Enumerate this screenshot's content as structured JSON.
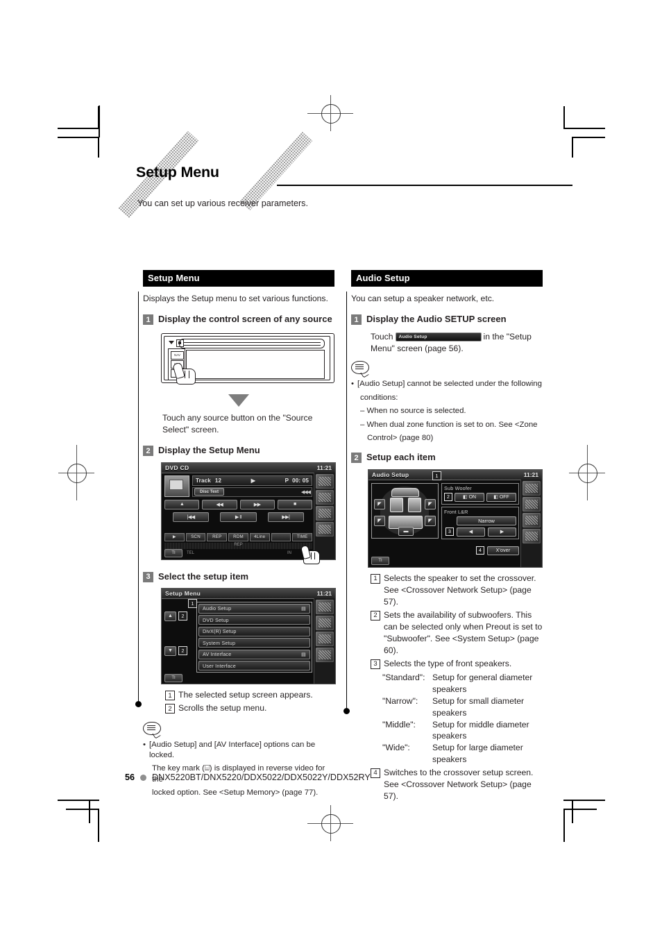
{
  "header": {
    "title": "Setup Menu",
    "subtitle": "You can set up various receiver parameters."
  },
  "left_column": {
    "section_title": "Setup Menu",
    "intro": "Displays the Setup menu to set various functions.",
    "step1": {
      "num": "1",
      "label": "Display the control screen of any source",
      "after_text_line1": "Touch any source button on the \"Source Select\"",
      "after_text_line2": "screen."
    },
    "step2": {
      "num": "2",
      "label": "Display the Setup Menu",
      "screen": {
        "title": "DVD CD",
        "clock": "11:21",
        "track_label": "Track",
        "track_num": "12",
        "play_icon": "▶",
        "p_label": "P",
        "time": "00: 05",
        "disc_text_button": "Disc Text",
        "scroll_arrows": "◀◀◀",
        "keys_row1": [
          "▲",
          "◀◀",
          "▶▶",
          "■"
        ],
        "keys_row2": [
          "|◀◀",
          "▶ II",
          "▶▶|"
        ],
        "func_keys": [
          "▶",
          "SCN",
          "REP",
          "RDM",
          "4Line",
          "",
          "TIME"
        ],
        "status": "REP",
        "tl_button": "TI",
        "tel_label": "TEL",
        "in_label": "IN"
      }
    },
    "step3": {
      "num": "3",
      "label": "Select the setup item",
      "screen": {
        "title": "Setup Menu",
        "clock": "11:21",
        "callout_1": "1",
        "callout_2": "2",
        "up_arrow": "▲",
        "down_arrow": "▼",
        "items": [
          {
            "label": "Audio Setup",
            "locked": "▤"
          },
          {
            "label": "DVD Setup",
            "locked": ""
          },
          {
            "label": "DivX(R) Setup",
            "locked": ""
          },
          {
            "label": "System Setup",
            "locked": ""
          },
          {
            "label": "AV Interface",
            "locked": "▤"
          },
          {
            "label": "User Interface",
            "locked": ""
          }
        ],
        "tl_button": "TI"
      },
      "callouts": [
        {
          "n": "1",
          "text": "The selected setup screen appears."
        },
        {
          "n": "2",
          "text": "Scrolls the setup menu."
        }
      ],
      "note": {
        "line1": "[Audio Setup]  and [AV Interface] options can be locked.",
        "line2": "The key mark (⌸) is displayed in reverse video for the",
        "line3": "locked option. See <Setup Memory> (page 77)."
      }
    }
  },
  "right_column": {
    "section_title": "Audio Setup",
    "intro": "You can setup a speaker network, etc.",
    "step1": {
      "num": "1",
      "label": "Display the Audio SETUP screen",
      "touch_prefix": "Touch",
      "pill_label": "Audio Setup",
      "touch_mid": "in the \"Setup",
      "touch_suffix": "Menu\" screen (page 56)."
    },
    "note": {
      "line1": "[Audio Setup] cannot be selected under the following",
      "line2": "conditions:",
      "sub1": "– When no source is selected.",
      "sub2": "– When dual zone function is set to on. See <Zone",
      "sub3": "Control> (page 80)"
    },
    "step2": {
      "num": "2",
      "label": "Setup each item",
      "screen": {
        "title": "Audio Setup",
        "clock": "11:21",
        "callout_1": "1",
        "callout_2": "2",
        "callout_3": "3",
        "callout_4": "4",
        "subwoofer_label": "Sub Woofer",
        "on_label": "ON",
        "off_label": "OFF",
        "front_label": "Front L&R",
        "front_value": "Narrow",
        "left_arrow": "◀",
        "right_arrow": "▶",
        "xover_button": "X'over",
        "speaker_icon": "◤",
        "subwoofer_icon": "▬",
        "tl_button": "TI"
      }
    },
    "callouts": [
      {
        "n": "1",
        "lines": [
          "Selects the speaker to set the crossover. See",
          "<Crossover Network Setup> (page 57)."
        ]
      },
      {
        "n": "2",
        "lines": [
          "Sets the availability of subwoofers. This",
          "can be selected only when Preout is set to",
          "\"Subwoofer\". See <System Setup> (page",
          "60)."
        ]
      },
      {
        "n": "3",
        "lines": [
          "Selects the type of front speakers."
        ]
      },
      {
        "n": "4",
        "lines": [
          "Switches to the crossover setup screen.",
          "See <Crossover Network Setup> (page 57)."
        ]
      }
    ],
    "speaker_types": [
      {
        "name": "\"Standard\":",
        "desc": "Setup for general diameter",
        "cont": "speakers"
      },
      {
        "name": "\"Narrow\":",
        "desc": "Setup for small diameter",
        "cont": "speakers"
      },
      {
        "name": "\"Middle\":",
        "desc": "Setup for middle diameter",
        "cont": "speakers"
      },
      {
        "name": "\"Wide\":",
        "desc": "Setup for large diameter",
        "cont": "speakers"
      }
    ]
  },
  "footer": {
    "page_number": "56",
    "models": "DNX5220BT/DNX5220/DDX5022/DDX5022Y/DDX52RY"
  }
}
